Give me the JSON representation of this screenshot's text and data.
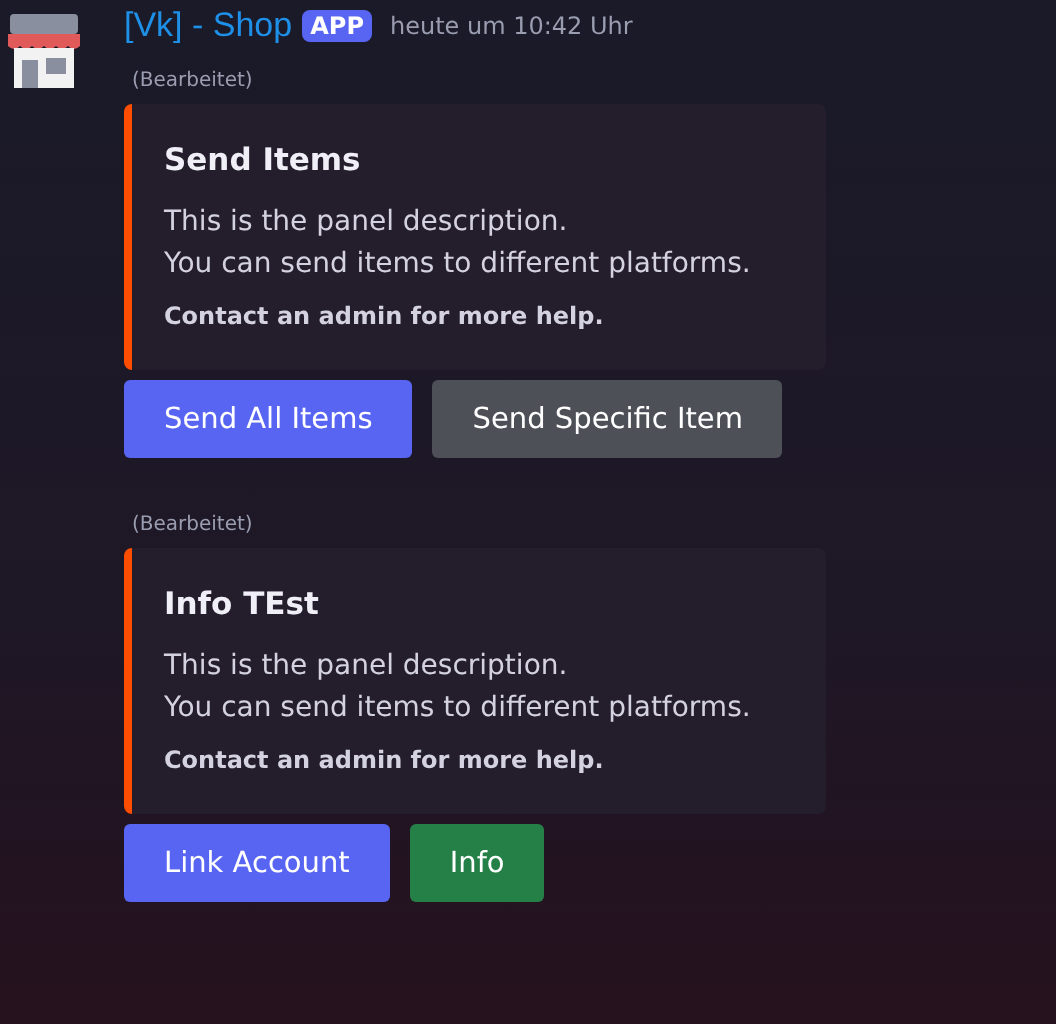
{
  "author": {
    "name": "[Vk] - Shop",
    "badge": "APP",
    "timestamp": "heute um 10:42 Uhr"
  },
  "messages": [
    {
      "edited": "(Bearbeitet)",
      "embed": {
        "title": "Send Items",
        "description": "This is the panel description.\nYou can send items to different platforms.",
        "footer": "Contact an admin for more help."
      },
      "buttons": [
        {
          "label": "Send All Items",
          "kind": "primary"
        },
        {
          "label": "Send Specific Item",
          "kind": "secondary"
        }
      ]
    },
    {
      "edited": "(Bearbeitet)",
      "embed": {
        "title": "Info TEst",
        "description": "This is the panel description.\nYou can send items to different platforms.",
        "footer": "Contact an admin for more help."
      },
      "buttons": [
        {
          "label": "Link Account",
          "kind": "primary"
        },
        {
          "label": "Info",
          "kind": "success"
        }
      ]
    }
  ]
}
